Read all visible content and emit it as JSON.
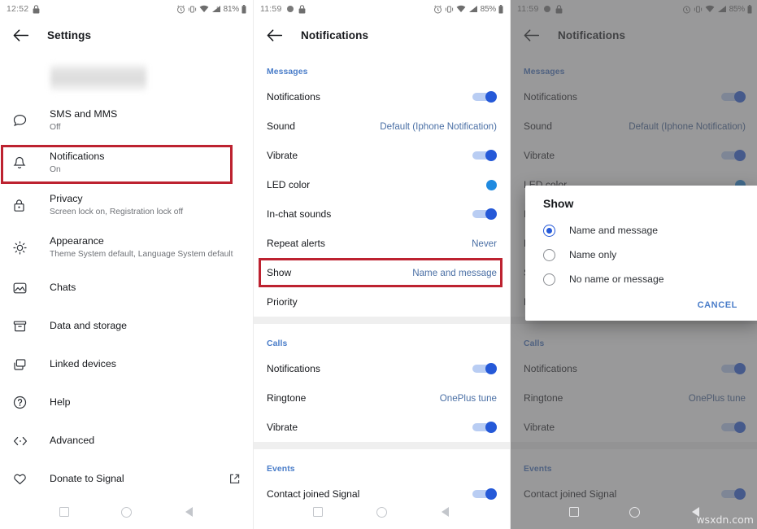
{
  "panel1": {
    "status": {
      "time": "12:52",
      "battery": "81%",
      "icons": [
        "lock-icon",
        "alarm-icon",
        "vibrate-icon",
        "wifi-icon",
        "signal-icon",
        "battery-icon"
      ]
    },
    "appbar": {
      "title": "Settings",
      "back_icon": "back-arrow-icon"
    },
    "profile_redacted": true,
    "items": [
      {
        "icon": "chat-bubble-icon",
        "title": "SMS and MMS",
        "subtitle": "Off",
        "trailing": ""
      },
      {
        "icon": "bell-icon",
        "title": "Notifications",
        "subtitle": "On",
        "trailing": "",
        "highlighted": true
      },
      {
        "icon": "lock-icon",
        "title": "Privacy",
        "subtitle": "Screen lock on, Registration lock off",
        "trailing": ""
      },
      {
        "icon": "brightness-icon",
        "title": "Appearance",
        "subtitle": "Theme System default, Language System default",
        "trailing": ""
      },
      {
        "icon": "image-icon",
        "title": "Chats",
        "subtitle": "",
        "trailing": ""
      },
      {
        "icon": "archive-icon",
        "title": "Data and storage",
        "subtitle": "",
        "trailing": ""
      },
      {
        "icon": "devices-icon",
        "title": "Linked devices",
        "subtitle": "",
        "trailing": ""
      },
      {
        "icon": "help-icon",
        "title": "Help",
        "subtitle": "",
        "trailing": ""
      },
      {
        "icon": "code-icon",
        "title": "Advanced",
        "subtitle": "",
        "trailing": ""
      },
      {
        "icon": "heart-icon",
        "title": "Donate to Signal",
        "subtitle": "",
        "trailing": "external-link-icon"
      }
    ],
    "navbar": {
      "recent": "square-icon",
      "home": "circle-icon",
      "back": "triangle-icon"
    }
  },
  "panel2": {
    "status": {
      "time": "11:59",
      "battery": "85%"
    },
    "appbar": {
      "title": "Notifications",
      "back_icon": "back-arrow-icon"
    },
    "sections": [
      {
        "header": "Messages",
        "rows": [
          {
            "label": "Notifications",
            "type": "toggle",
            "value": "on"
          },
          {
            "label": "Sound",
            "type": "value",
            "value": "Default (Iphone Notification)"
          },
          {
            "label": "Vibrate",
            "type": "toggle",
            "value": "on"
          },
          {
            "label": "LED color",
            "type": "swatch",
            "value": "blue"
          },
          {
            "label": "In-chat sounds",
            "type": "toggle",
            "value": "on"
          },
          {
            "label": "Repeat alerts",
            "type": "value",
            "value": "Never"
          },
          {
            "label": "Show",
            "type": "value",
            "value": "Name and message",
            "highlighted": true
          },
          {
            "label": "Priority",
            "type": "value",
            "value": ""
          }
        ]
      },
      {
        "header": "Calls",
        "rows": [
          {
            "label": "Notifications",
            "type": "toggle",
            "value": "on"
          },
          {
            "label": "Ringtone",
            "type": "value",
            "value": "OnePlus tune"
          },
          {
            "label": "Vibrate",
            "type": "toggle",
            "value": "on"
          }
        ]
      },
      {
        "header": "Events",
        "rows": [
          {
            "label": "Contact joined Signal",
            "type": "toggle",
            "value": "on"
          }
        ]
      }
    ]
  },
  "panel3": {
    "status": {
      "time": "11:59",
      "battery": "85%"
    },
    "appbar": {
      "title": "Notifications",
      "back_icon": "back-arrow-icon"
    },
    "dialog": {
      "title": "Show",
      "options": [
        {
          "label": "Name and message",
          "selected": true
        },
        {
          "label": "Name only",
          "selected": false
        },
        {
          "label": "No name or message",
          "selected": false
        }
      ],
      "cancel_label": "CANCEL"
    }
  },
  "watermark": "wsxdn.com",
  "colors": {
    "accent": "#2559d8",
    "section_header": "#4a7dc9",
    "value_text": "#4a6fa5",
    "highlight_box": "#bd2230",
    "led_swatch": "#1f8ae0"
  }
}
